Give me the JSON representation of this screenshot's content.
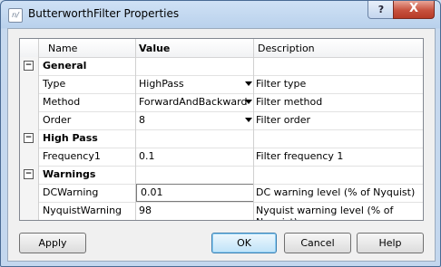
{
  "window": {
    "title": "ButterworthFilter Properties",
    "help_glyph": "?",
    "close_glyph": "X",
    "icon_glyph": "n/"
  },
  "grid": {
    "headers": {
      "name": "Name",
      "value": "Value",
      "description": "Description"
    },
    "rows": [
      {
        "kind": "group",
        "name": "General",
        "expander": "−"
      },
      {
        "kind": "prop",
        "name": "Type",
        "value": "HighPass",
        "description": "Filter type",
        "dropdown": true
      },
      {
        "kind": "prop",
        "name": "Method",
        "value": "ForwardAndBackward",
        "description": "Filter method",
        "dropdown": true
      },
      {
        "kind": "prop",
        "name": "Order",
        "value": "8",
        "description": "Filter order",
        "dropdown": true
      },
      {
        "kind": "group",
        "name": "High Pass",
        "expander": "−"
      },
      {
        "kind": "prop",
        "name": "Frequency1",
        "value": "0.1",
        "description": "Filter frequency 1"
      },
      {
        "kind": "group",
        "name": "Warnings",
        "expander": "−"
      },
      {
        "kind": "prop",
        "name": "DCWarning",
        "value": "0.01",
        "description": "DC warning level (% of Nyquist)",
        "editing": true
      },
      {
        "kind": "prop",
        "name": "NyquistWarning",
        "value": "98",
        "description": "Nyquist warning level (% of Nyquist)"
      }
    ]
  },
  "buttons": {
    "apply": "Apply",
    "ok": "OK",
    "cancel": "Cancel",
    "help": "Help"
  }
}
